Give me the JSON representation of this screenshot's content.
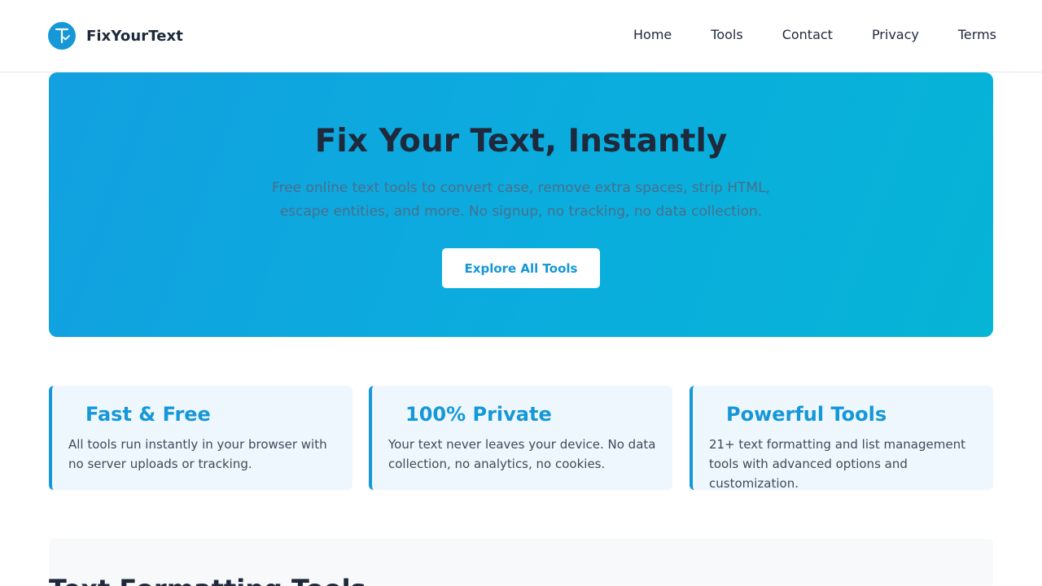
{
  "header": {
    "brand": "FixYourText",
    "logo_icon": "text-check-icon",
    "nav": [
      "Home",
      "Tools",
      "Contact",
      "Privacy",
      "Terms"
    ]
  },
  "hero": {
    "title": "Fix Your Text, Instantly",
    "subtitle": "Free online text tools to convert case, remove extra spaces, strip HTML, escape entities, and more. No signup, no tracking, no data collection.",
    "button": "Explore All Tools"
  },
  "features": [
    {
      "title": "Fast & Free",
      "text": "All tools run instantly in your browser with no server uploads or tracking."
    },
    {
      "title": "100% Private",
      "text": "Your text never leaves your device. No data collection, no analytics, no cookies."
    },
    {
      "title": "Powerful Tools",
      "text": "21+ text formatting and list management tools with advanced options and customization."
    }
  ],
  "section": {
    "title": "Text Formatting Tools"
  },
  "colors": {
    "accent": "#1597d8",
    "hero_start": "#12a0e0",
    "hero_end": "#06b4d6",
    "text_dark": "#1e293b"
  }
}
